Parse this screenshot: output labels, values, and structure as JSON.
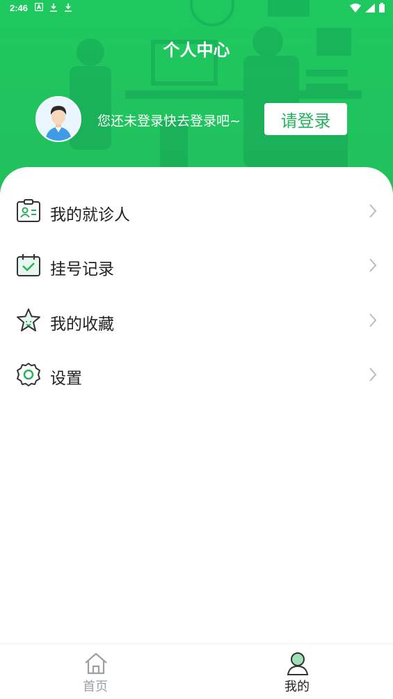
{
  "status_bar": {
    "time": "2:46",
    "left_icons": [
      "a-badge-icon",
      "download-icon",
      "download-icon"
    ],
    "right_icons": [
      "wifi-icon",
      "signal-icon",
      "battery-icon"
    ]
  },
  "header": {
    "title": "个人中心",
    "login_hint": "您还未登录快去登录吧~",
    "login_button": "请登录"
  },
  "menu": {
    "items": [
      {
        "label": "我的就诊人",
        "icon": "patient-card-icon"
      },
      {
        "label": "挂号记录",
        "icon": "calendar-check-icon"
      },
      {
        "label": "我的收藏",
        "icon": "star-icon"
      },
      {
        "label": "设置",
        "icon": "gear-icon"
      }
    ]
  },
  "tabbar": {
    "home_label": "首页",
    "mine_label": "我的"
  },
  "colors": {
    "brand_green": "#22bf5c",
    "accent_green": "#22b35a",
    "inactive_gray": "#9aa0a6"
  }
}
